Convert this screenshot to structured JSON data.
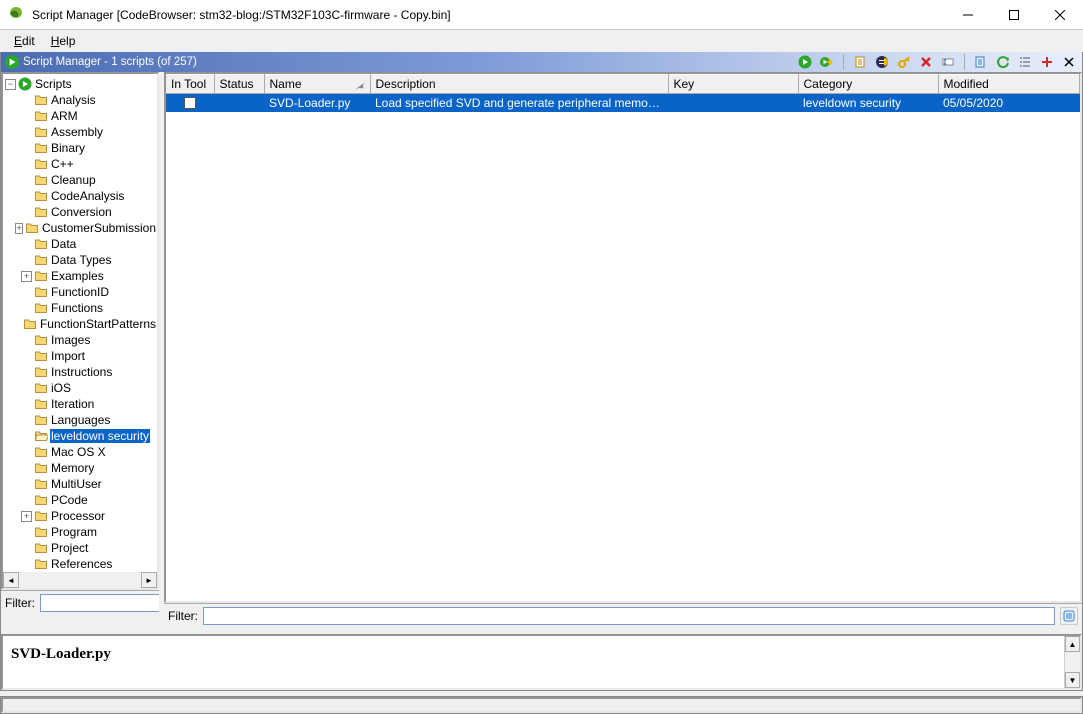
{
  "window": {
    "title": "Script Manager [CodeBrowser: stm32-blog:/STM32F103C-firmware - Copy.bin]"
  },
  "menu": {
    "edit": "Edit",
    "help": "Help"
  },
  "componentTitle": "Script Manager - 1 scripts  (of 257)",
  "tree": {
    "root": "Scripts",
    "items": [
      {
        "label": "Analysis",
        "expand": "none"
      },
      {
        "label": "ARM",
        "expand": "none"
      },
      {
        "label": "Assembly",
        "expand": "none"
      },
      {
        "label": "Binary",
        "expand": "none"
      },
      {
        "label": "C++",
        "expand": "none"
      },
      {
        "label": "Cleanup",
        "expand": "none"
      },
      {
        "label": "CodeAnalysis",
        "expand": "none"
      },
      {
        "label": "Conversion",
        "expand": "none"
      },
      {
        "label": "CustomerSubmission",
        "expand": "plus"
      },
      {
        "label": "Data",
        "expand": "none"
      },
      {
        "label": "Data Types",
        "expand": "none"
      },
      {
        "label": "Examples",
        "expand": "plus"
      },
      {
        "label": "FunctionID",
        "expand": "none"
      },
      {
        "label": "Functions",
        "expand": "none"
      },
      {
        "label": "FunctionStartPatterns",
        "expand": "none"
      },
      {
        "label": "Images",
        "expand": "none"
      },
      {
        "label": "Import",
        "expand": "none"
      },
      {
        "label": "Instructions",
        "expand": "none"
      },
      {
        "label": "iOS",
        "expand": "none"
      },
      {
        "label": "Iteration",
        "expand": "none"
      },
      {
        "label": "Languages",
        "expand": "none"
      },
      {
        "label": "leveldown security",
        "expand": "none",
        "selected": true
      },
      {
        "label": "Mac OS X",
        "expand": "none"
      },
      {
        "label": "Memory",
        "expand": "none"
      },
      {
        "label": "MultiUser",
        "expand": "none"
      },
      {
        "label": "PCode",
        "expand": "none"
      },
      {
        "label": "Processor",
        "expand": "plus"
      },
      {
        "label": "Program",
        "expand": "none"
      },
      {
        "label": "Project",
        "expand": "none"
      },
      {
        "label": "References",
        "expand": "none"
      }
    ]
  },
  "table": {
    "columns": {
      "inTool": "In Tool",
      "status": "Status",
      "name": "Name",
      "description": "Description",
      "key": "Key",
      "category": "Category",
      "modified": "Modified"
    },
    "rows": [
      {
        "inTool": false,
        "status": "",
        "name": "SVD-Loader.py",
        "description": "Load specified SVD and generate peripheral memory map…",
        "key": "",
        "category": "leveldown security",
        "modified": "05/05/2020",
        "selected": true
      }
    ]
  },
  "filter": {
    "leftLabel": "Filter:",
    "rightLabel": "Filter:",
    "leftValue": "",
    "rightValue": ""
  },
  "details": {
    "title": "SVD-Loader.py"
  }
}
